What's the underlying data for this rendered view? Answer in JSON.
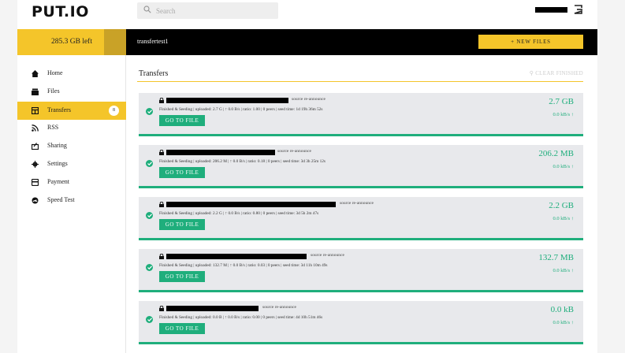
{
  "header": {
    "logo": "PUT.IO",
    "search_placeholder": "Search"
  },
  "account": {
    "space_left": "285.3 GB left",
    "space_used_fraction": 0.8
  },
  "breadcrumb": "transfertest1",
  "new_files_label": "+ NEW FILES",
  "sidebar": {
    "items": [
      {
        "label": "Home",
        "icon": "home-icon"
      },
      {
        "label": "Files",
        "icon": "files-icon"
      },
      {
        "label": "Transfers",
        "icon": "transfers-icon",
        "active": true,
        "badge": "8"
      },
      {
        "label": "RSS",
        "icon": "rss-icon"
      },
      {
        "label": "Sharing",
        "icon": "sharing-icon"
      },
      {
        "label": "Settings",
        "icon": "gear-icon"
      },
      {
        "label": "Payment",
        "icon": "payment-icon"
      },
      {
        "label": "Speed Test",
        "icon": "speedometer-icon"
      }
    ]
  },
  "main": {
    "title": "Transfers",
    "clear_finished": "CLEAR FINISHED"
  },
  "transfers": [
    {
      "tags": "source re-announce",
      "status": "Finished & Seeding | uploaded: 2.7 G | ↑ 0.0 B/s | ratio: 1.00 | 0 peers | seed time: 1d 19h 36m 52s",
      "go_to": "GO TO FILE",
      "size": "2.7 GB",
      "speed": "0.0 kB/s"
    },
    {
      "tags": "source re-announce",
      "status": "Finished & Seeding | uploaded: 206.2 M | ↑ 0.0 B/s | ratio: 0.18 | 0 peers | seed time: 3d 3h 25m 12s",
      "go_to": "GO TO FILE",
      "size": "206.2 MB",
      "speed": "0.0 kB/s"
    },
    {
      "tags": "source re-announce",
      "status": "Finished & Seeding | uploaded: 2.2 G | ↑ 0.0 B/s | ratio: 0.80 | 0 peers | seed time: 3d 5h 2m 47s",
      "go_to": "GO TO FILE",
      "size": "2.2 GB",
      "speed": "0.0 kB/s"
    },
    {
      "tags": "source re-announce",
      "status": "Finished & Seeding | uploaded: 132.7 M | ↑ 0.0 B/s | ratio: 0.03 | 0 peers | seed time: 3d 11h 10m 49s",
      "go_to": "GO TO FILE",
      "size": "132.7 MB",
      "speed": "0.0 kB/s"
    },
    {
      "tags": "source re-announce",
      "status": "Finished & Seeding | uploaded: 0.0 B | ↑ 0.0 B/s | ratio: 0.00 | 0 peers | seed time: 4d 10h 51m 46s",
      "go_to": "GO TO FILE",
      "size": "0.0 kB",
      "speed": "0.0 kB/s"
    }
  ],
  "colors": {
    "accent": "#f4c52a",
    "success": "#1fae7c"
  }
}
